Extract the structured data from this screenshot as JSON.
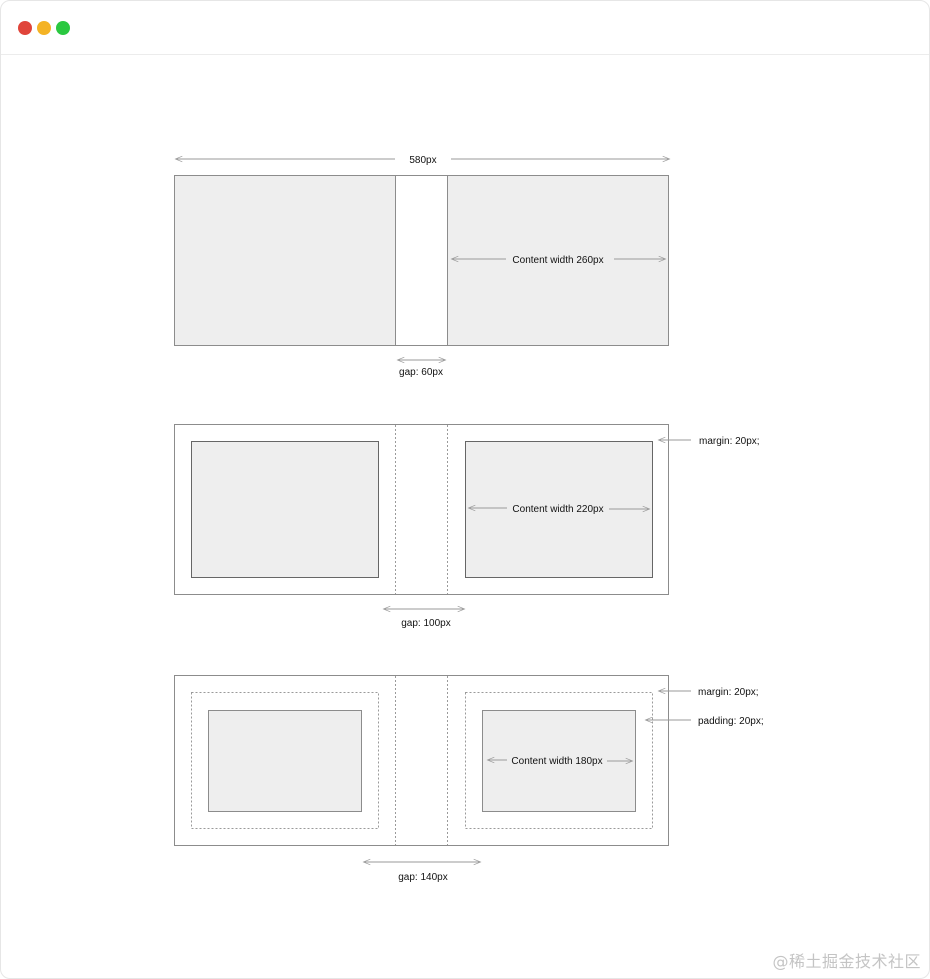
{
  "window": {
    "controls": [
      {
        "name": "close",
        "color": "#e0443a"
      },
      {
        "name": "minimize",
        "color": "#f4b325"
      },
      {
        "name": "maximize",
        "color": "#2ac840"
      }
    ]
  },
  "diagram": {
    "total_width_label": "580px",
    "example1": {
      "content_label": "Content width 260px",
      "gap_label": "gap: 60px"
    },
    "example2": {
      "content_label": "Content width 220px",
      "gap_label": "gap: 100px",
      "margin_label": "margin: 20px;"
    },
    "example3": {
      "content_label": "Content width 180px",
      "gap_label": "gap: 140px",
      "margin_label": "margin: 20px;",
      "padding_label": "padding: 20px;"
    }
  },
  "colors": {
    "box_fill": "#eeeeee",
    "stroke": "#8c8c8c",
    "arrow": "#9a9a9a"
  },
  "watermark": "@稀土掘金技术社区"
}
